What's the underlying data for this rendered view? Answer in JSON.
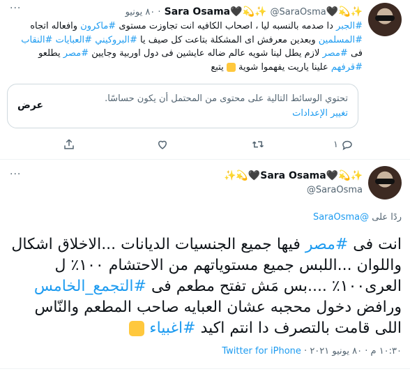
{
  "tweet1": {
    "name": "✨💫🖤Sara Osama🖤💫✨",
    "handle": "@SaraOsma",
    "date": "٨٠ يونيو",
    "text_parts": [
      {
        "t": "#الجبر",
        "link": true
      },
      {
        "t": " دا صدمه بالنسبه ليا ، اصحاب الكافيه انت تجاوزت مستوى ",
        "link": false
      },
      {
        "t": "#ماكرون",
        "link": true
      },
      {
        "t": " وافعاله اتجاه ",
        "link": false
      },
      {
        "t": "#المسلمين",
        "link": true
      },
      {
        "t": " وبعدين معرفش اى المشكلة بتاعت كل صيف يا ",
        "link": false
      },
      {
        "t": "#البروكيني",
        "link": true
      },
      {
        "t": " ",
        "link": false
      },
      {
        "t": "#العبايات",
        "link": true
      },
      {
        "t": " ",
        "link": false
      },
      {
        "t": "#النقاب",
        "link": true
      },
      {
        "t": " فى ",
        "link": false
      },
      {
        "t": "#مصر",
        "link": true
      },
      {
        "t": " لازم يطل لينا شويه عالم ضاله عايشين فى دول اوربية وجايين ",
        "link": false
      },
      {
        "t": "#مصر",
        "link": true
      },
      {
        "t": " يطلعو ",
        "link": false
      },
      {
        "t": "#قرفهم",
        "link": true
      },
      {
        "t": " علينا ياريت يفهموا شوية ",
        "link": false
      }
    ],
    "follow_label": "يتبع",
    "sensitive_text": "تحتوي الوسائط التالية على محتوى من المحتمل أن يكون حساسًا.",
    "change_settings": "تغيير الإعدادات",
    "view_label": "عرض",
    "reply_count": "١"
  },
  "tweet2": {
    "name": "✨💫🖤Sara Osama🖤💫✨",
    "handle": "@SaraOsma",
    "replying_prefix": "ردًا على",
    "replying_handle": "@SaraOsma",
    "text_parts": [
      {
        "t": "انت فى ",
        "link": false
      },
      {
        "t": "#مصر",
        "link": true
      },
      {
        "t": " فيها جميع الجنسيات الديانات ...الاخلاق اشكال واللوان ...اللبس جميع مستوياتهم من الاحتشام ١٠٠٪ ل العرى١٠٠٪ ....بس مَش تفتح مطعم فى ",
        "link": false
      },
      {
        "t": "#التجمع_الخامس",
        "link": true
      },
      {
        "t": " ورافض دخول محجبه عشان العبايه صاحب المطعم والنّاس اللى قامت بالتصرف دا انتم اكيد ",
        "link": false
      },
      {
        "t": "#اغبياء",
        "link": true
      },
      {
        "t": " ",
        "link": false
      }
    ],
    "time": "١٠:٣٠ م",
    "date": "٨٠ يونيو ٢٠٢١",
    "source": "Twitter for iPhone"
  },
  "colors": {
    "link": "#1d9bf0",
    "muted": "#536471",
    "border": "#cfd9de"
  },
  "icons": [
    "more-icon",
    "reply-icon",
    "retweet-icon",
    "like-icon",
    "share-icon",
    "thumbs-up-icon",
    "pointing-hand-icon"
  ]
}
